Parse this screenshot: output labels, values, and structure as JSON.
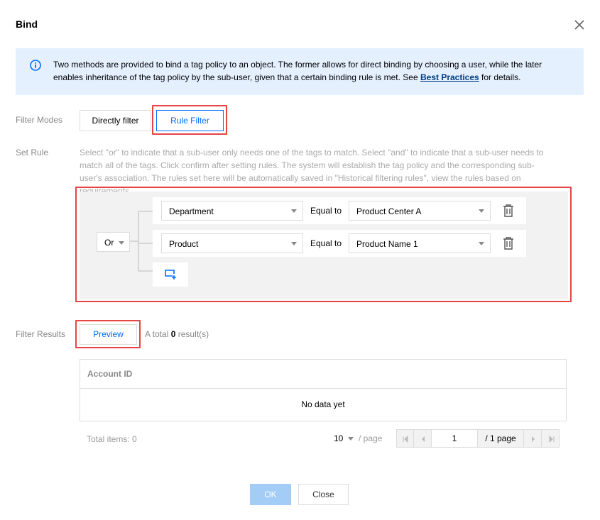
{
  "dialog": {
    "title": "Bind"
  },
  "notice": {
    "text_before": "Two methods are provided to bind a tag policy to an object. The former allows for direct binding by choosing a user, while the later enables inheritance of the tag policy by the sub-user, given that a certain binding rule is met. See ",
    "link": "Best Practices",
    "text_after": " for details."
  },
  "filter_modes": {
    "label": "Filter Modes",
    "options": [
      "Directly filter",
      "Rule Filter"
    ],
    "selected": "Rule Filter"
  },
  "set_rule": {
    "label": "Set Rule",
    "description": "Select \"or\" to indicate that a sub-user only needs one of the tags to match. Select \"and\" to indicate that a sub-user needs to match all of the tags. Click confirm after setting rules. The system will establish the tag policy and the corresponding sub-user's association. The rules set here will be automatically saved in \"Historical filtering rules\", view the rules based on requirements.",
    "logic": "Or",
    "rules": [
      {
        "key": "Department",
        "operator": "Equal to",
        "value": "Product Center A"
      },
      {
        "key": "Product",
        "operator": "Equal to",
        "value": "Product Name 1"
      }
    ]
  },
  "filter_results": {
    "label": "Filter Results",
    "preview_label": "Preview",
    "total_prefix": "A total ",
    "total_count": "0",
    "total_suffix": " result(s)"
  },
  "table": {
    "columns": [
      "Account ID"
    ],
    "empty_text": "No data yet"
  },
  "pagination": {
    "total_items": "Total items:  0",
    "page_size": "10",
    "per_page_label": "/ page",
    "current_page": "1",
    "total_pages": "/ 1 page"
  },
  "footer": {
    "ok_label": "OK",
    "close_label": "Close"
  },
  "colors": {
    "accent": "#006eff",
    "highlight_border": "#e54545",
    "notice_bg": "#e5f0ff",
    "ok_disabled": "#a3cdf7"
  }
}
